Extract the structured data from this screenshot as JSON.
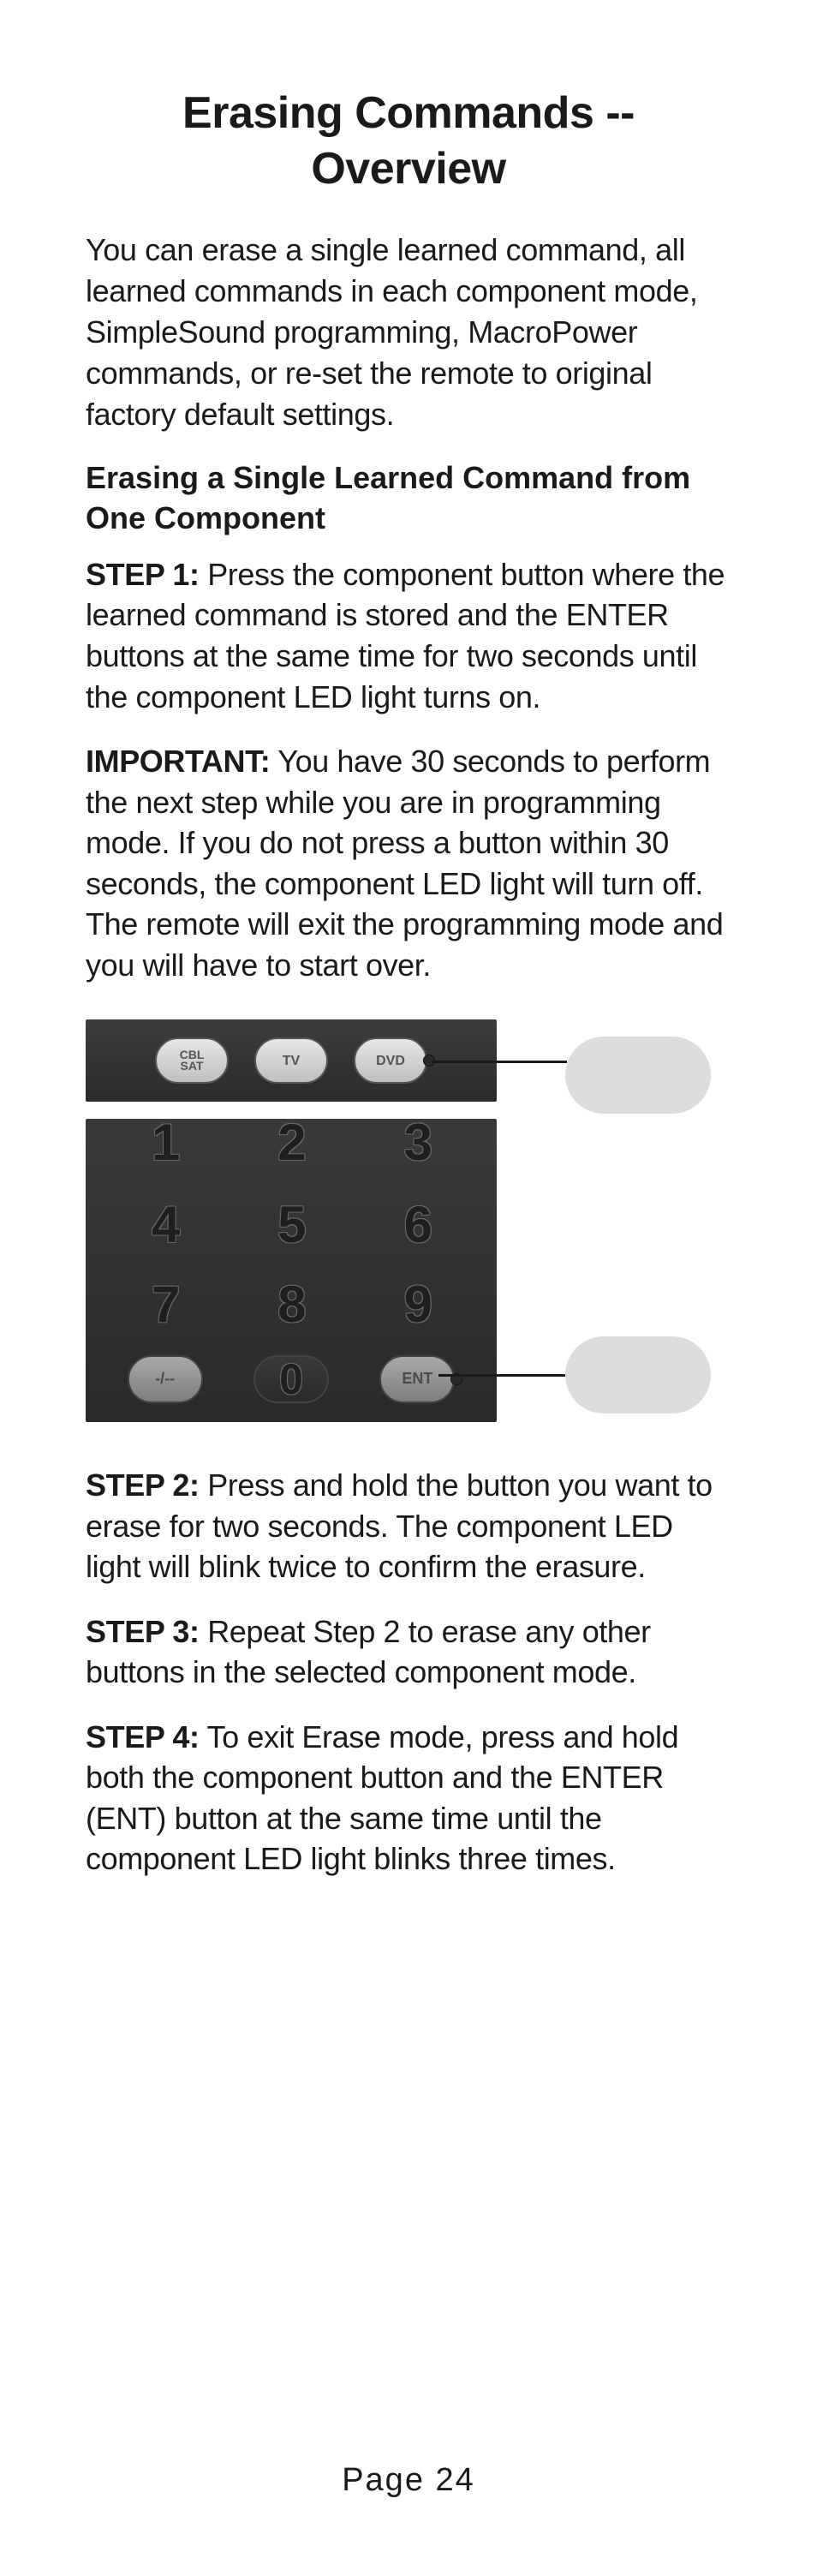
{
  "title": "Erasing Commands -- Overview",
  "intro": "You can erase a single learned command, all learned commands in each component mode, SimpleSound programming, MacroPower commands, or re-set the remote to original factory default settings.",
  "subhead": "Erasing a Single Learned Command from One Component",
  "step1": {
    "lead": "STEP 1:",
    "text": " Press the component button where the learned command is stored and the ENTER buttons at the same time for two seconds until the component LED light turns on."
  },
  "important": {
    "lead": "IMPORTANT:",
    "text": " You have 30 seconds to perform the next step while you are in programming mode. If you do not press a button within 30 seconds, the component LED light will turn off. The remote will exit the programming mode and you will have to start over."
  },
  "diagram": {
    "top_buttons": {
      "cbl_sat_line1": "CBL",
      "cbl_sat_line2": "SAT",
      "tv": "TV",
      "dvd": "DVD"
    },
    "keypad": {
      "row0": [
        "1",
        "2",
        "3"
      ],
      "row1": [
        "4",
        "5",
        "6"
      ],
      "row2": [
        "7",
        "8",
        "9"
      ],
      "row3_left": "-/--",
      "row3_mid": "0",
      "row3_right": "ENT"
    }
  },
  "step2": {
    "lead": "STEP 2:",
    "text": " Press and hold the button you want to erase for two seconds. The component LED light will blink twice to confirm the erasure."
  },
  "step3": {
    "lead": "STEP 3:",
    "text": " Repeat Step 2 to erase any other buttons in the selected component mode."
  },
  "step4": {
    "lead": "STEP 4:",
    "text": " To exit Erase mode, press and hold both the component button and the ENTER (ENT) button at the same time until the component LED light blinks three times."
  },
  "page_number": "Page 24"
}
